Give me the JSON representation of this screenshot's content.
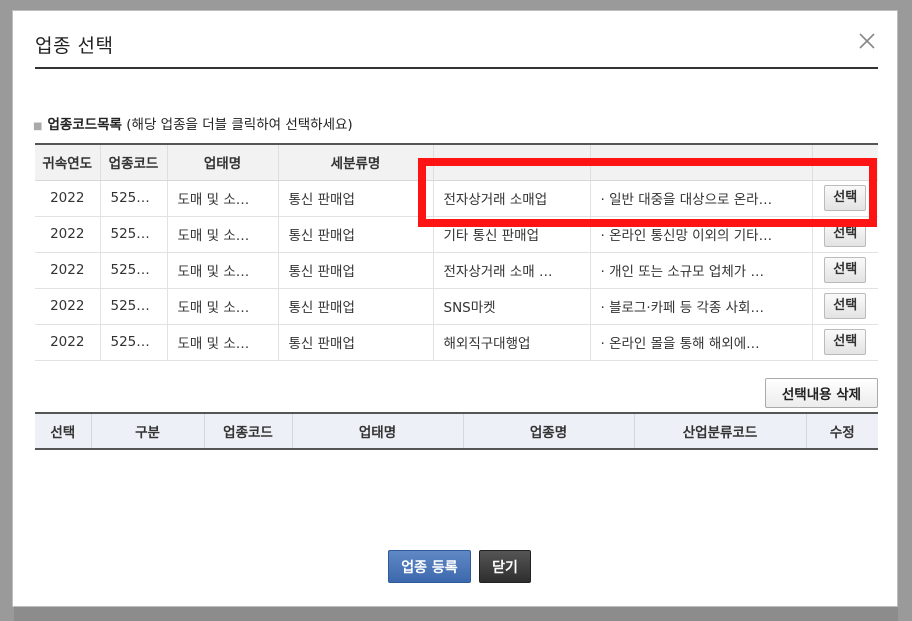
{
  "modal": {
    "title": "업종 선택",
    "section_label_bold": "업종코드목록",
    "section_label_hint": "(해당 업종을 더블 클릭하여 선택하세요)"
  },
  "list_table": {
    "headers": [
      "귀속연도",
      "업종코드",
      "업태명",
      "세분류명",
      "",
      "",
      ""
    ],
    "select_label": "선택",
    "rows": [
      {
        "year": "2022",
        "code": "525…",
        "business": "도매 및 소…",
        "subclass": "통신 판매업",
        "type": "전자상거래 소매업",
        "desc": "· 일반 대중을 대상으로 온라…"
      },
      {
        "year": "2022",
        "code": "525…",
        "business": "도매 및 소…",
        "subclass": "통신 판매업",
        "type": "기타 통신 판매업",
        "desc": "· 온라인 통신망 이외의 기타…"
      },
      {
        "year": "2022",
        "code": "525…",
        "business": "도매 및 소…",
        "subclass": "통신 판매업",
        "type": "전자상거래 소매 …",
        "desc": "· 개인 또는 소규모 업체가 …"
      },
      {
        "year": "2022",
        "code": "525…",
        "business": "도매 및 소…",
        "subclass": "통신 판매업",
        "type": "SNS마켓",
        "desc": "· 블로그·카페 등 각종 사회…"
      },
      {
        "year": "2022",
        "code": "525…",
        "business": "도매 및 소…",
        "subclass": "통신 판매업",
        "type": "해외직구대행업",
        "desc": "·  온라인 몰을 통해 해외에…"
      }
    ]
  },
  "delete_button": "선택내용 삭제",
  "selected_table": {
    "headers": [
      "선택",
      "구분",
      "업종코드",
      "업태명",
      "업종명",
      "산업분류코드",
      "수정"
    ]
  },
  "footer": {
    "register_label": "업종 등록",
    "close_label": "닫기"
  },
  "colors": {
    "highlight": "#ff1414",
    "primary_button": "#3d69ad",
    "dark_button": "#2e2e2e"
  }
}
